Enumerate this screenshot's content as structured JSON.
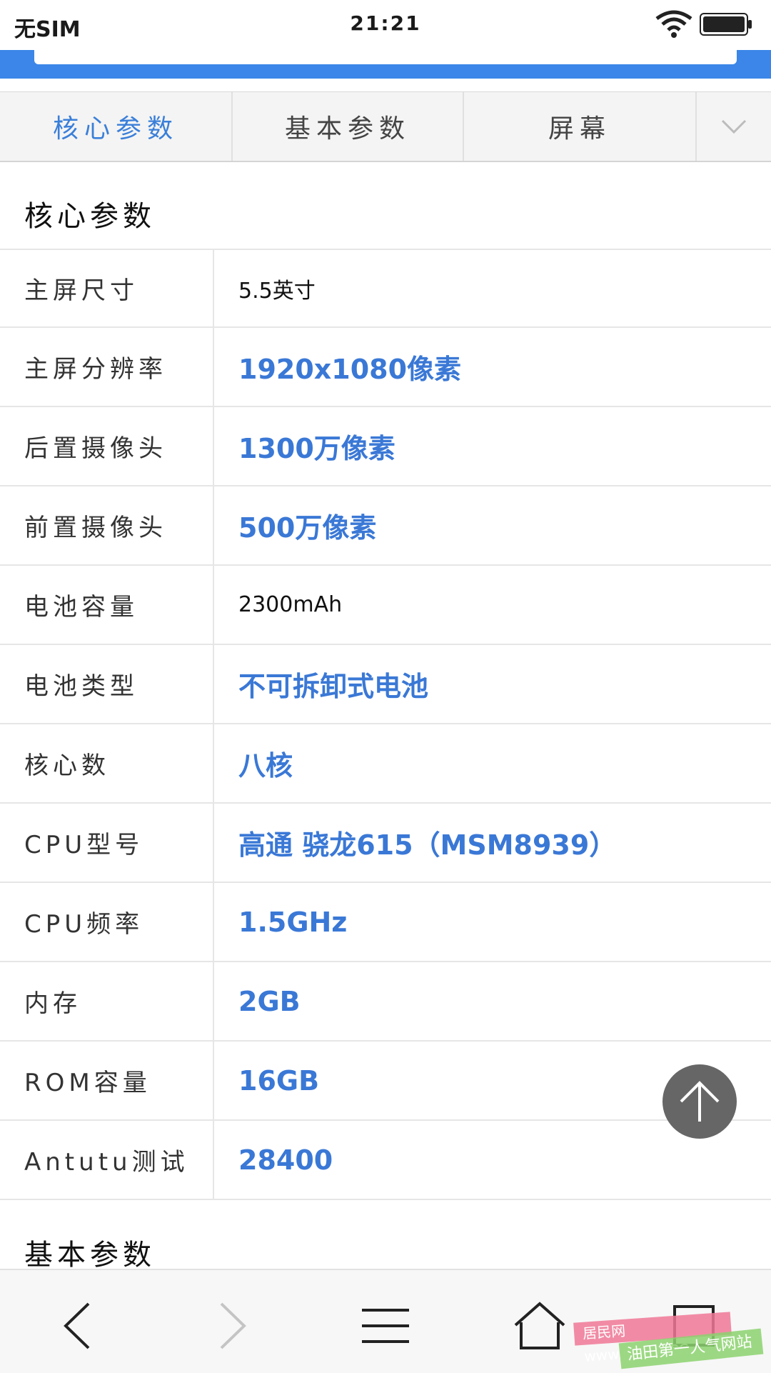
{
  "status_bar": {
    "carrier": "无SIM",
    "time": "21:21"
  },
  "tabs": [
    {
      "label": "核心参数",
      "active": true
    },
    {
      "label": "基本参数",
      "active": false
    },
    {
      "label": "屏幕",
      "active": false
    }
  ],
  "section_core": {
    "title": "核心参数",
    "rows": [
      {
        "label": "主屏尺寸",
        "value": "5.5英寸",
        "highlight": false
      },
      {
        "label": "主屏分辨率",
        "value": "1920x1080像素",
        "highlight": true
      },
      {
        "label": "后置摄像头",
        "value": "1300万像素",
        "highlight": true
      },
      {
        "label": "前置摄像头",
        "value": "500万像素",
        "highlight": true
      },
      {
        "label": "电池容量",
        "value": "2300mAh",
        "highlight": false
      },
      {
        "label": "电池类型",
        "value": "不可拆卸式电池",
        "highlight": true
      },
      {
        "label": "核心数",
        "value": "八核",
        "highlight": true
      },
      {
        "label": "CPU型号",
        "value": "高通 骁龙615（MSM8939）",
        "highlight": true
      },
      {
        "label": "CPU频率",
        "value": "1.5GHz",
        "highlight": true
      },
      {
        "label": "内存",
        "value": "2GB",
        "highlight": true
      },
      {
        "label": "ROM容量",
        "value": "16GB",
        "highlight": true
      },
      {
        "label": "Antutu测试",
        "value": "28400",
        "highlight": true
      }
    ]
  },
  "section_basic": {
    "title": "基本参数"
  },
  "watermark": {
    "line1": "居民网 www.JUMIN.CC",
    "line2": "油田第一人气网站"
  },
  "colors": {
    "accent_blue": "#3a78d6",
    "header_blue": "#3b86e8",
    "top_button": "#666666"
  },
  "icons": {
    "back": "chevron-left-icon",
    "forward": "chevron-right-icon",
    "menu": "menu-icon",
    "home": "home-icon",
    "windows": "windows-icon",
    "scroll_top": "arrow-up-icon"
  }
}
